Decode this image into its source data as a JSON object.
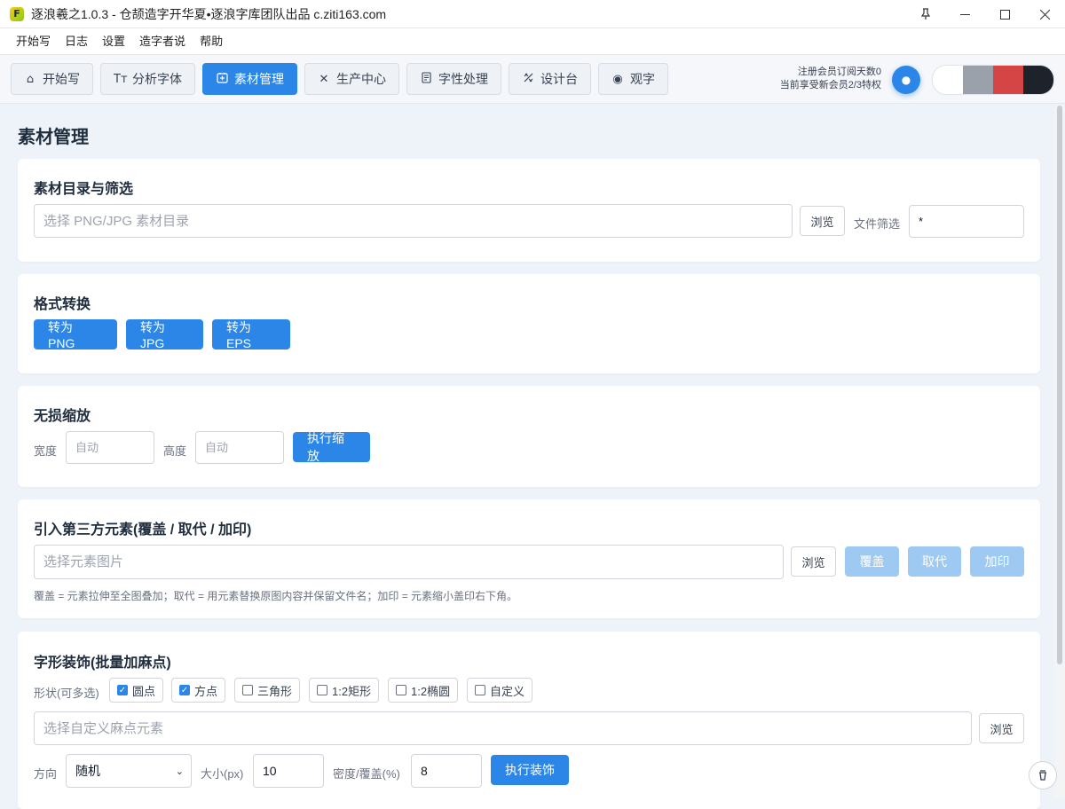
{
  "window": {
    "title": "逐浪羲之1.0.3 - 仓颉造字开华夏•逐浪字库团队出品 c.ziti163.com",
    "app_icon_letter": "F",
    "pin_icon": "pin-icon",
    "minimize_icon": "minimize-icon",
    "maximize_icon": "maximize-icon",
    "close_icon": "close-icon"
  },
  "menu": {
    "items": [
      "开始写",
      "日志",
      "设置",
      "造字者说",
      "帮助"
    ]
  },
  "tabs": [
    {
      "label": "开始写",
      "icon": "home-icon",
      "active": false
    },
    {
      "label": "分析字体",
      "icon": "text-size-icon",
      "active": false
    },
    {
      "label": "素材管理",
      "icon": "image-add-icon",
      "active": true
    },
    {
      "label": "生产中心",
      "icon": "tools-icon",
      "active": false
    },
    {
      "label": "字性处理",
      "icon": "document-icon",
      "active": false
    },
    {
      "label": "设计台",
      "icon": "design-icon",
      "active": false
    },
    {
      "label": "观字",
      "icon": "eye-icon",
      "active": false
    }
  ],
  "member": {
    "line1": "注册会员订阅天数0",
    "line2": "当前享受新会员2/3特权"
  },
  "theme": {
    "swatches": [
      "#ffffff",
      "#9aa1ab",
      "#d64545",
      "#1e232b"
    ],
    "accent": "#2b86e8"
  },
  "page": {
    "title": "素材管理"
  },
  "source_dir": {
    "title": "素材目录与筛选",
    "placeholder": "选择 PNG/JPG 素材目录",
    "browse_label": "浏览",
    "filter_label": "文件筛选",
    "filter_value": "*"
  },
  "convert": {
    "title": "格式转换",
    "buttons": [
      "转为 PNG",
      "转为 JPG",
      "转为 EPS"
    ]
  },
  "scale": {
    "title": "无损缩放",
    "width_label": "宽度",
    "width_placeholder": "自动",
    "height_label": "高度",
    "height_placeholder": "自动",
    "run_label": "执行缩放"
  },
  "third_party": {
    "title": "引入第三方元素(覆盖 / 取代 / 加印)",
    "placeholder": "选择元素图片",
    "browse_label": "浏览",
    "cover_label": "覆盖",
    "replace_label": "取代",
    "stamp_label": "加印",
    "hint": "覆盖 = 元素拉伸至全图叠加；取代 = 用元素替换原图内容并保留文件名；加印 = 元素缩小盖印右下角。"
  },
  "decoration": {
    "title": "字形装饰(批量加麻点)",
    "shape_label": "形状(可多选)",
    "shapes": [
      {
        "label": "圆点",
        "checked": true
      },
      {
        "label": "方点",
        "checked": true
      },
      {
        "label": "三角形",
        "checked": false
      },
      {
        "label": "1:2矩形",
        "checked": false
      },
      {
        "label": "1:2椭圆",
        "checked": false
      },
      {
        "label": "自定义",
        "checked": false
      }
    ],
    "custom_placeholder": "选择自定义麻点元素",
    "browse_label": "浏览",
    "direction_label": "方向",
    "direction_value": "随机",
    "size_label": "大小(px)",
    "size_value": "10",
    "density_label": "密度/覆盖(%)",
    "density_value": "8",
    "run_label": "执行装饰"
  }
}
